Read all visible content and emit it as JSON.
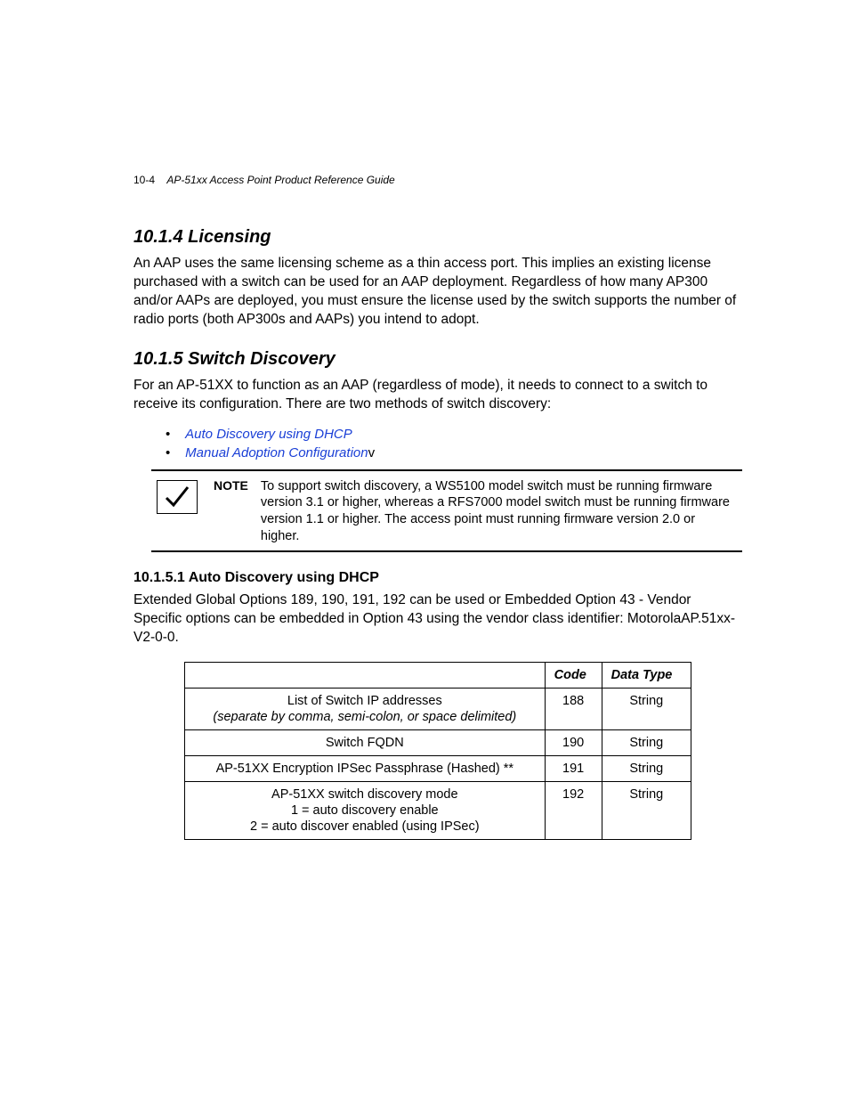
{
  "header": {
    "page_num": "10-4",
    "doc_title": "AP-51xx Access Point Product Reference Guide"
  },
  "sections": {
    "licensing": {
      "num": "10.1.4",
      "title": "Licensing",
      "body": "An AAP uses the same licensing scheme as a thin access port. This implies an existing license purchased with a switch can be used for an AAP deployment. Regardless of how many AP300 and/or AAPs are deployed, you must ensure the license used by the switch supports the number of radio ports (both AP300s and AAPs) you intend to adopt."
    },
    "discovery": {
      "num": "10.1.5",
      "title": "Switch Discovery",
      "body": "For an AP-51XX to function as an AAP (regardless of mode), it needs to connect to a switch to receive its configuration. There are two methods of switch discovery:",
      "links": {
        "a": "Auto Discovery using DHCP",
        "b": "Manual Adoption Configuration",
        "b_suffix": "v"
      },
      "note": {
        "label": "NOTE",
        "text": "To support switch discovery, a WS5100 model switch must be running firmware version 3.1 or higher, whereas a RFS7000 model switch must be running firmware version 1.1 or higher. The access point must running firmware version 2.0 or higher."
      },
      "sub": {
        "num": "10.1.5.1",
        "title": "Auto Discovery using DHCP",
        "body": "Extended Global Options 189, 190, 191, 192 can be used or Embedded Option 43 - Vendor Specific options can be embedded in Option 43 using the vendor class identifier: MotorolaAP.51xx-V2-0-0."
      }
    }
  },
  "table": {
    "headers": {
      "c2": "Code",
      "c3": "Data Type"
    },
    "rows": [
      {
        "desc": "List of Switch IP addresses",
        "sub": "(separate by comma, semi-colon, or space delimited)",
        "code": "188",
        "type": "String"
      },
      {
        "desc": "Switch FQDN",
        "code": "190",
        "type": "String"
      },
      {
        "desc": "AP-51XX Encryption IPSec Passphrase (Hashed) **",
        "code": "191",
        "type": "String"
      },
      {
        "desc": "AP-51XX switch discovery mode",
        "line2": "1 = auto discovery enable",
        "line3": "2 = auto discover enabled (using IPSec)",
        "code": "192",
        "type": "String"
      }
    ]
  }
}
